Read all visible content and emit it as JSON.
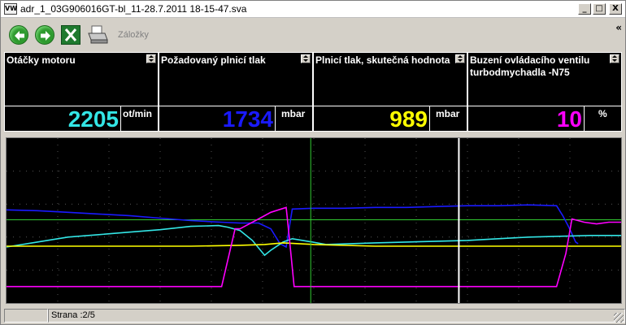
{
  "window": {
    "title": "adr_1_03G906016GT-bl_11-28.7.2011 18-15-47.sva",
    "app_icon_label": "VW",
    "minimize": "_",
    "maximize": "□",
    "close": "X"
  },
  "toolbar": {
    "back_icon": "green-arrow-left-icon",
    "forward_icon": "green-arrow-right-icon",
    "excel_icon": "excel-icon",
    "print_icon": "printer-icon",
    "bookmarks_label": "Záložky",
    "collapse": "«"
  },
  "panels": [
    {
      "name": "Otáčky motoru",
      "value": "2205",
      "unit": "ot/min",
      "color": "#33e6e6"
    },
    {
      "name": "Požadovaný plnicí tlak",
      "value": "1734",
      "unit": "mbar",
      "color": "#1a1aff"
    },
    {
      "name": "Plnicí tlak, skutečná hodnota",
      "value": "989",
      "unit": "mbar",
      "color": "#ffff00"
    },
    {
      "name": "Buzení ovládacího ventilu turbodmychadla -N75",
      "value": "10",
      "unit": "%",
      "color": "#ff00ff"
    }
  ],
  "status": {
    "page": "Strana :2/5"
  },
  "chart_data": {
    "type": "line",
    "xlim": [
      0,
      100
    ],
    "ylim": [
      0,
      100
    ],
    "grid": true,
    "cursors": [
      {
        "x": 49.5,
        "color": "#33cc33"
      },
      {
        "x": 73.6,
        "color": "#ffffff"
      }
    ],
    "reference_line": {
      "y": 50.5,
      "color": "#33cc33"
    },
    "series": [
      {
        "color": "#1a1aff",
        "points": [
          [
            0,
            56.5
          ],
          [
            5,
            56
          ],
          [
            10,
            55
          ],
          [
            15,
            54
          ],
          [
            20,
            53
          ],
          [
            25,
            51.5
          ],
          [
            30,
            50
          ],
          [
            35,
            49
          ],
          [
            38,
            48.5
          ],
          [
            41,
            48.5
          ],
          [
            43,
            45
          ],
          [
            44.5,
            36
          ],
          [
            45.5,
            34
          ],
          [
            46.5,
            57
          ],
          [
            50,
            57.5
          ],
          [
            55,
            57.5
          ],
          [
            60,
            58
          ],
          [
            65,
            58
          ],
          [
            70,
            58.5
          ],
          [
            75,
            59
          ],
          [
            80,
            59
          ],
          [
            85,
            59.5
          ],
          [
            89.5,
            59
          ],
          [
            90.5,
            53
          ],
          [
            91.5,
            46
          ],
          [
            92,
            42
          ],
          [
            92.6,
            37
          ],
          [
            93,
            36
          ]
        ]
      },
      {
        "color": "#33e6e6",
        "points": [
          [
            0,
            34
          ],
          [
            5,
            37
          ],
          [
            10,
            40
          ],
          [
            15,
            41.5
          ],
          [
            20,
            43
          ],
          [
            25,
            44.5
          ],
          [
            30,
            46.5
          ],
          [
            34.5,
            47
          ],
          [
            36,
            46
          ],
          [
            38,
            44
          ],
          [
            40,
            38
          ],
          [
            42,
            29
          ],
          [
            43,
            32
          ],
          [
            45,
            37
          ],
          [
            46.5,
            39
          ],
          [
            49,
            37.5
          ],
          [
            52,
            35.5
          ],
          [
            56,
            36
          ],
          [
            60,
            36.5
          ],
          [
            65,
            37
          ],
          [
            70,
            37.5
          ],
          [
            75,
            38
          ],
          [
            80,
            39
          ],
          [
            85,
            40
          ],
          [
            90,
            40.5
          ],
          [
            95,
            41
          ],
          [
            100,
            41
          ]
        ]
      },
      {
        "color": "#ffff00",
        "points": [
          [
            0,
            34.5
          ],
          [
            10,
            34.5
          ],
          [
            20,
            34.5
          ],
          [
            30,
            34.5
          ],
          [
            38,
            35
          ],
          [
            42,
            35.5
          ],
          [
            45,
            36.5
          ],
          [
            50,
            35.5
          ],
          [
            60,
            34.5
          ],
          [
            70,
            34.5
          ],
          [
            80,
            34.5
          ],
          [
            90,
            34.5
          ],
          [
            100,
            34.5
          ]
        ]
      },
      {
        "color": "#ff00ff",
        "points": [
          [
            0,
            10
          ],
          [
            10,
            10
          ],
          [
            20,
            10
          ],
          [
            30,
            10
          ],
          [
            35,
            10
          ],
          [
            37.2,
            45
          ],
          [
            38,
            45
          ],
          [
            39,
            47
          ],
          [
            41,
            51
          ],
          [
            43,
            55
          ],
          [
            45.5,
            58
          ],
          [
            46,
            40
          ],
          [
            46.8,
            10
          ],
          [
            50,
            10
          ],
          [
            60,
            10
          ],
          [
            70,
            10
          ],
          [
            80,
            10
          ],
          [
            89.5,
            10
          ],
          [
            91,
            30
          ],
          [
            92,
            51
          ],
          [
            94,
            49
          ],
          [
            96,
            48
          ],
          [
            98,
            49
          ],
          [
            100,
            49
          ]
        ]
      }
    ]
  }
}
